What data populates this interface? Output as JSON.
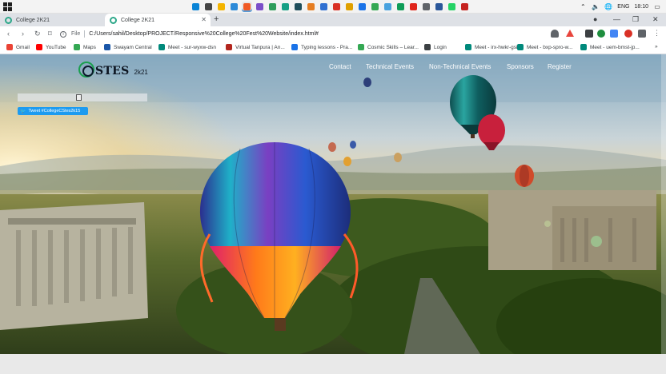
{
  "taskbar": {
    "icons": [
      {
        "name": "edge-icon",
        "color": "#0a84d6"
      },
      {
        "name": "store-icon",
        "color": "#444444"
      },
      {
        "name": "folder-icon",
        "color": "#f4b400"
      },
      {
        "name": "vscode-icon",
        "color": "#2c8ad8"
      },
      {
        "name": "brave-icon",
        "color": "#f05a24",
        "active": true
      },
      {
        "name": "app-purple-icon",
        "color": "#7b4fc9"
      },
      {
        "name": "app-green-icon",
        "color": "#2f9e5b"
      },
      {
        "name": "app-teal-icon",
        "color": "#16a085"
      },
      {
        "name": "app-dark-icon",
        "color": "#1f4e5b"
      },
      {
        "name": "app-orange-icon",
        "color": "#e67e22"
      },
      {
        "name": "app-blue-icon",
        "color": "#2e6fd1"
      },
      {
        "name": "app-red-icon",
        "color": "#d93025"
      },
      {
        "name": "app-gold-icon",
        "color": "#e0a000"
      },
      {
        "name": "onedrive-icon",
        "color": "#1a73e8"
      },
      {
        "name": "chrome-icon",
        "color": "#34a853"
      },
      {
        "name": "app-lightblue-icon",
        "color": "#4aa3df"
      },
      {
        "name": "app-green2-icon",
        "color": "#0f9d58"
      },
      {
        "name": "opera-icon",
        "color": "#e0251b"
      },
      {
        "name": "app-gray-icon",
        "color": "#5f6368"
      },
      {
        "name": "word-icon",
        "color": "#2b579a"
      },
      {
        "name": "whatsapp-icon",
        "color": "#25d366"
      },
      {
        "name": "app-red2-icon",
        "color": "#c5221f"
      }
    ],
    "language": "ENG",
    "time": "18:10"
  },
  "tabs": [
    {
      "title": "College 2K21",
      "active": false
    },
    {
      "title": "College 2K21",
      "active": true
    }
  ],
  "address": {
    "scheme_label": "File",
    "url": "C:/Users/sahil/Desktop/PROJECT/Responsive%20College%20Fest%20Website/index.html#"
  },
  "bookmarks": [
    {
      "label": "Gmail",
      "icon": "gmail-icon",
      "color": "#ea4335"
    },
    {
      "label": "YouTube",
      "icon": "youtube-icon",
      "color": "#ff0000"
    },
    {
      "label": "Maps",
      "icon": "maps-icon",
      "color": "#34a853"
    },
    {
      "label": "Swayam Central",
      "icon": "swayam-icon",
      "color": "#1a56a8"
    },
    {
      "label": "Meet - sur-wyxw-dsn",
      "icon": "meet-icon",
      "color": "#00897b"
    },
    {
      "label": "Virtual Tanpura | An...",
      "icon": "tanpura-icon",
      "color": "#b3261e"
    },
    {
      "label": "Typing lessons - Pra...",
      "icon": "typing-icon",
      "color": "#1a73e8"
    },
    {
      "label": "Cosmic Skills – Lear...",
      "icon": "cosmic-icon",
      "color": "#34a853"
    },
    {
      "label": "Login",
      "icon": "login-icon",
      "color": "#3c4043"
    },
    {
      "label": "Meet - irx-hwkr-gsi",
      "icon": "meet-icon",
      "color": "#00897b"
    },
    {
      "label": "Meet - bxp-spro-w...",
      "icon": "meet-icon",
      "color": "#00897b"
    },
    {
      "label": "Meet - uem-bmst-jp...",
      "icon": "meet-icon",
      "color": "#00897b"
    }
  ],
  "site": {
    "logo_text": "STES",
    "logo_year": "2k21",
    "menu": [
      "Contact",
      "Technical Events",
      "Non-Technical Events",
      "Sponsors",
      "Register"
    ],
    "tweet_label": "Tweet #CollegeCStes2k15"
  }
}
